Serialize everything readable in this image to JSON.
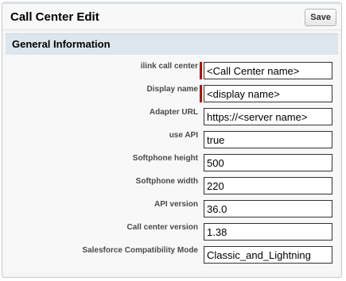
{
  "header": {
    "title": "Call Center Edit",
    "save_label": "Save"
  },
  "section": {
    "title": "General Information"
  },
  "fields": [
    {
      "label": "ilink call center",
      "value": "<Call Center name>",
      "required": true
    },
    {
      "label": "Display name",
      "value": "<display name>",
      "required": true
    },
    {
      "label": "Adapter URL",
      "value": "https://<server name>",
      "required": false
    },
    {
      "label": "use API",
      "value": "true",
      "required": false
    },
    {
      "label": "Softphone height",
      "value": "500",
      "required": false
    },
    {
      "label": "Softphone width",
      "value": "220",
      "required": false
    },
    {
      "label": "API version",
      "value": "36.0",
      "required": false
    },
    {
      "label": "Call center version",
      "value": "1.38",
      "required": false
    },
    {
      "label": "Salesforce Compatibility Mode",
      "value": "Classic_and_Lightning",
      "required": false
    }
  ],
  "colors": {
    "required_marker": "#c00000",
    "section_background": "#dde5ed"
  }
}
